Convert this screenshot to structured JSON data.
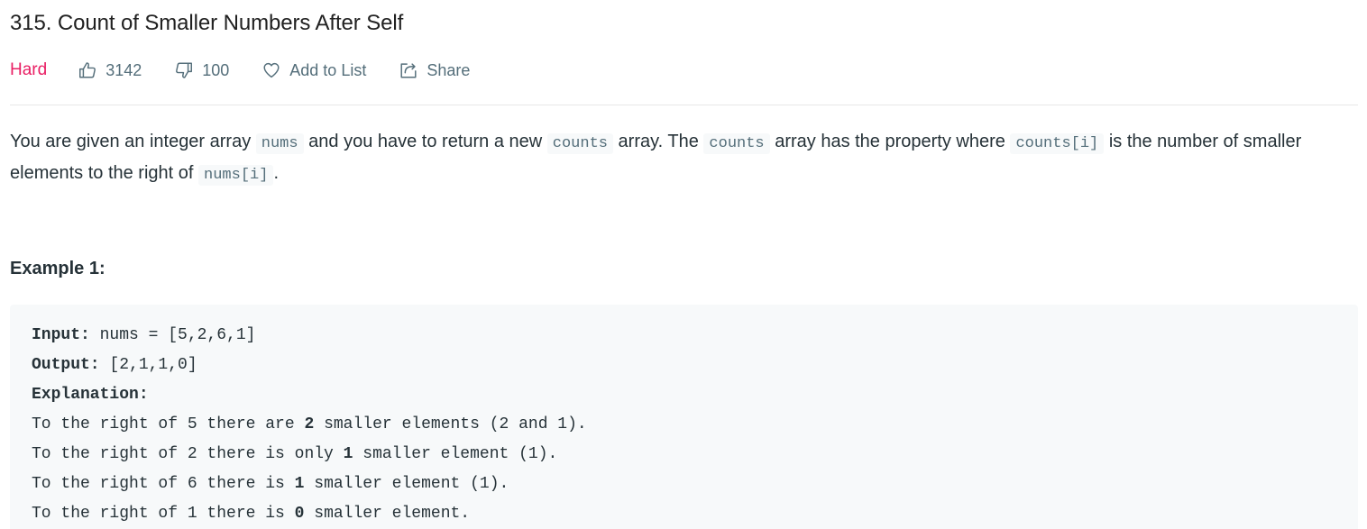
{
  "problem": {
    "title": "315. Count of Smaller Numbers After Self",
    "difficulty": "Hard",
    "difficulty_color": "#e91e63",
    "likes": "3142",
    "dislikes": "100",
    "add_to_list_label": "Add to List",
    "share_label": "Share"
  },
  "icons": {
    "like": "thumbs-up-icon",
    "dislike": "thumbs-down-icon",
    "favorite": "heart-icon",
    "share": "share-icon"
  },
  "description": {
    "part1": "You are given an integer array ",
    "code1": "nums",
    "part2": " and you have to return a new ",
    "code2": "counts",
    "part3": " array. The ",
    "code3": "counts",
    "part4": " array has the property where ",
    "code4": "counts[i]",
    "part5": " is the number of smaller elements to the right of ",
    "code5": "nums[i]",
    "part6": "."
  },
  "example": {
    "heading": "Example 1:",
    "input_label": "Input:",
    "input_value": " nums = [5,2,6,1]",
    "output_label": "Output:",
    "output_value": " [2,1,1,0]",
    "explanation_label": "Explanation:",
    "lines": [
      {
        "a": "To the right of 5 there are ",
        "b": "2",
        "c": " smaller elements (2 and 1)."
      },
      {
        "a": "To the right of 2 there is only ",
        "b": "1",
        "c": " smaller element (1)."
      },
      {
        "a": "To the right of 6 there is ",
        "b": "1",
        "c": " smaller element (1)."
      },
      {
        "a": "To the right of 1 there is ",
        "b": "0",
        "c": " smaller element."
      }
    ]
  }
}
